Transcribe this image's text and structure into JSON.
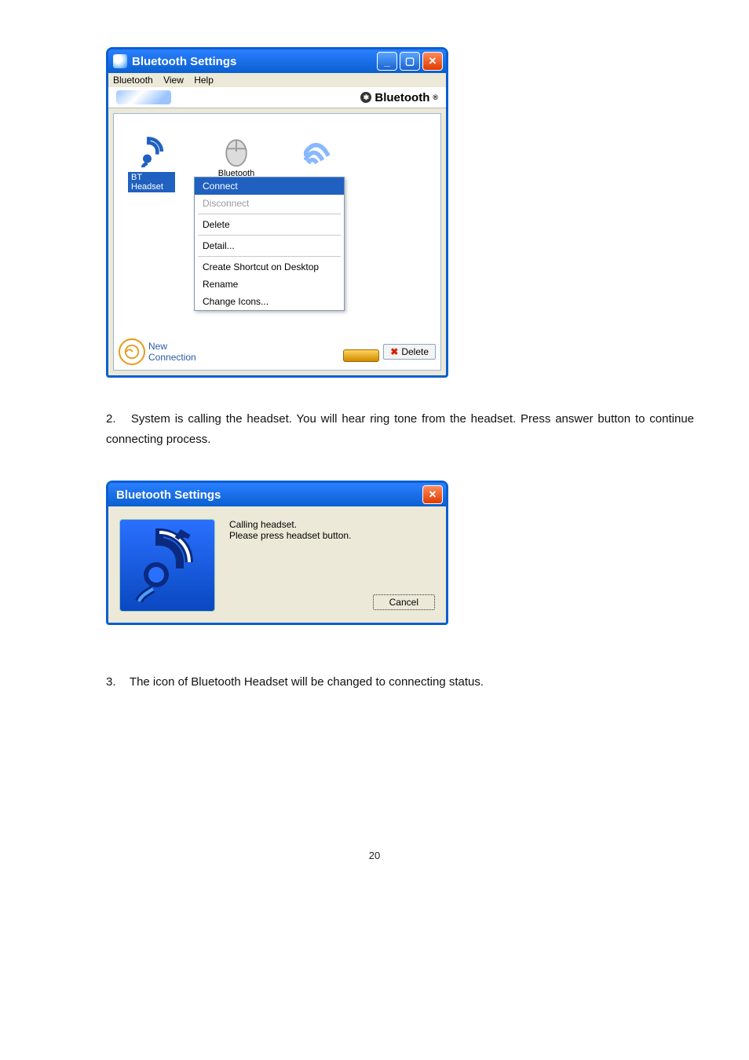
{
  "window1": {
    "title": "Bluetooth Settings",
    "menus": {
      "m1": "Bluetooth",
      "m2": "View",
      "m3": "Help"
    },
    "brand": "Bluetooth",
    "device1_label": "BT Headset",
    "device2_label": "Bluetooth",
    "context_menu": {
      "connect": "Connect",
      "disconnect": "Disconnect",
      "delete": "Delete",
      "detail": "Detail...",
      "shortcut": "Create Shortcut on Desktop",
      "rename": "Rename",
      "change_icons": "Change Icons..."
    },
    "new_connection_line1": "New",
    "new_connection_line2": "Connection",
    "delete_button": "Delete"
  },
  "step2": {
    "num": "2.",
    "text": "System is calling the headset. You will hear ring tone from the headset. Press answer button to continue connecting process."
  },
  "window2": {
    "title": "Bluetooth Settings",
    "msg_line1": "Calling headset.",
    "msg_line2": "Please press headset button.",
    "cancel": "Cancel"
  },
  "step3": {
    "num": "3.",
    "text": "The icon of Bluetooth Headset will be changed to connecting status."
  },
  "page_number": "20"
}
